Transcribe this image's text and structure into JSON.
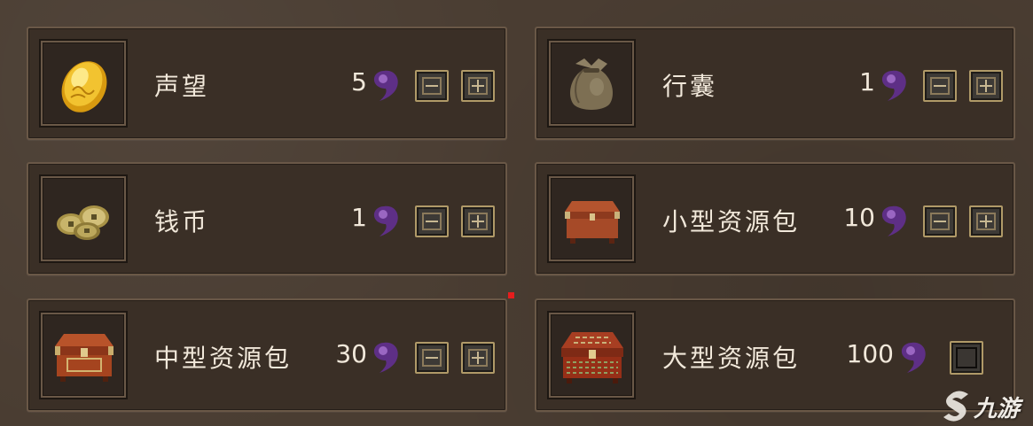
{
  "items": [
    {
      "name": "声望",
      "quantity": "5",
      "icon": "gold-ingot-icon",
      "controls": "stepper"
    },
    {
      "name": "行囊",
      "quantity": "1",
      "icon": "cloth-sack-icon",
      "controls": "stepper"
    },
    {
      "name": "钱币",
      "quantity": "1",
      "icon": "coins-icon",
      "controls": "stepper"
    },
    {
      "name": "小型资源包",
      "quantity": "10",
      "icon": "small-chest-icon",
      "controls": "stepper"
    },
    {
      "name": "中型资源包",
      "quantity": "30",
      "icon": "medium-chest-icon",
      "controls": "stepper"
    },
    {
      "name": "大型资源包",
      "quantity": "100",
      "icon": "large-chest-icon",
      "controls": "checkbox"
    }
  ],
  "currency_icon": "purple-magatama-icon",
  "colors": {
    "background": "#4a3d32",
    "card": "#3a2f26",
    "card_border": "#6a5847",
    "text": "#f1e8da",
    "currency": "#5e2f86",
    "button_border": "#b09a68"
  },
  "watermark": {
    "text": "九游"
  }
}
